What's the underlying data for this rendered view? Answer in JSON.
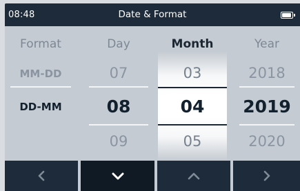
{
  "status": {
    "time": "08:48",
    "title": "Date & Format",
    "battery_icon": "battery-full-icon"
  },
  "columns": {
    "format": {
      "header": "Format",
      "items": [
        "MM-DD",
        "DD-MM"
      ],
      "selected": "DD-MM"
    },
    "day": {
      "header": "Day",
      "prev": "07",
      "selected": "08",
      "next": "09"
    },
    "month": {
      "header": "Month",
      "prev": "03",
      "selected": "04",
      "next": "05"
    },
    "year": {
      "header": "Year",
      "prev": "2018",
      "selected": "2019",
      "next": "2020"
    }
  },
  "active_column": "month",
  "nav": {
    "buttons": [
      {
        "icon": "chevron-left-icon"
      },
      {
        "icon": "chevron-down-icon"
      },
      {
        "icon": "chevron-up-icon"
      },
      {
        "icon": "chevron-right-icon"
      }
    ]
  },
  "colors": {
    "bar": "#1d2b3a",
    "background": "#c5cbd2",
    "selected_text": "#13212f",
    "muted_text": "#8a95a1"
  }
}
